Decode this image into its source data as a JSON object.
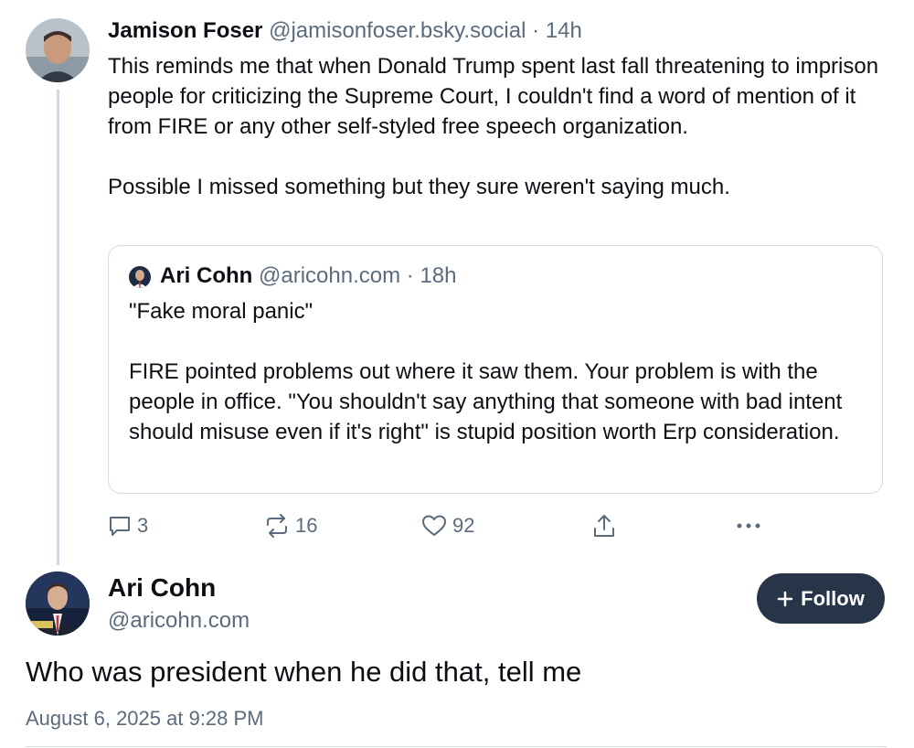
{
  "original_post": {
    "author_name": "Jamison Foser",
    "author_handle": "@jamisonfoser.bsky.social",
    "time_ago": "14h",
    "separator": "·",
    "text": "This reminds me that when Donald Trump spent last fall threatening to imprison people for criticizing the Supreme Court, I couldn't find a word of mention of it from FIRE or any other self-styled free speech organization.\n\nPossible I missed something but they sure weren't saying much.",
    "quote": {
      "author_name": "Ari Cohn",
      "author_handle": "@aricohn.com",
      "time_ago": "18h",
      "text": "\"Fake moral panic\"\n\nFIRE pointed problems out where it saw them. Your problem is with the people in office. \"You shouldn't say anything that someone with bad intent should misuse even if it's right\" is stupid position worth Erp consideration."
    },
    "actions": {
      "reply_count": "3",
      "repost_count": "16",
      "like_count": "92"
    }
  },
  "reply_post": {
    "author_name": "Ari Cohn",
    "author_handle": "@aricohn.com",
    "follow_label": "Follow",
    "text": "Who was president when he did that, tell me",
    "timestamp": "August 6, 2025 at 9:28 PM"
  },
  "colors": {
    "muted": "#5b6b7d",
    "follow_bg": "#263548",
    "thread_line": "#cfd9e3",
    "border": "#d4dde6"
  },
  "icons": [
    "reply-icon",
    "repost-icon",
    "like-icon",
    "share-icon",
    "more-icon",
    "plus-icon"
  ]
}
